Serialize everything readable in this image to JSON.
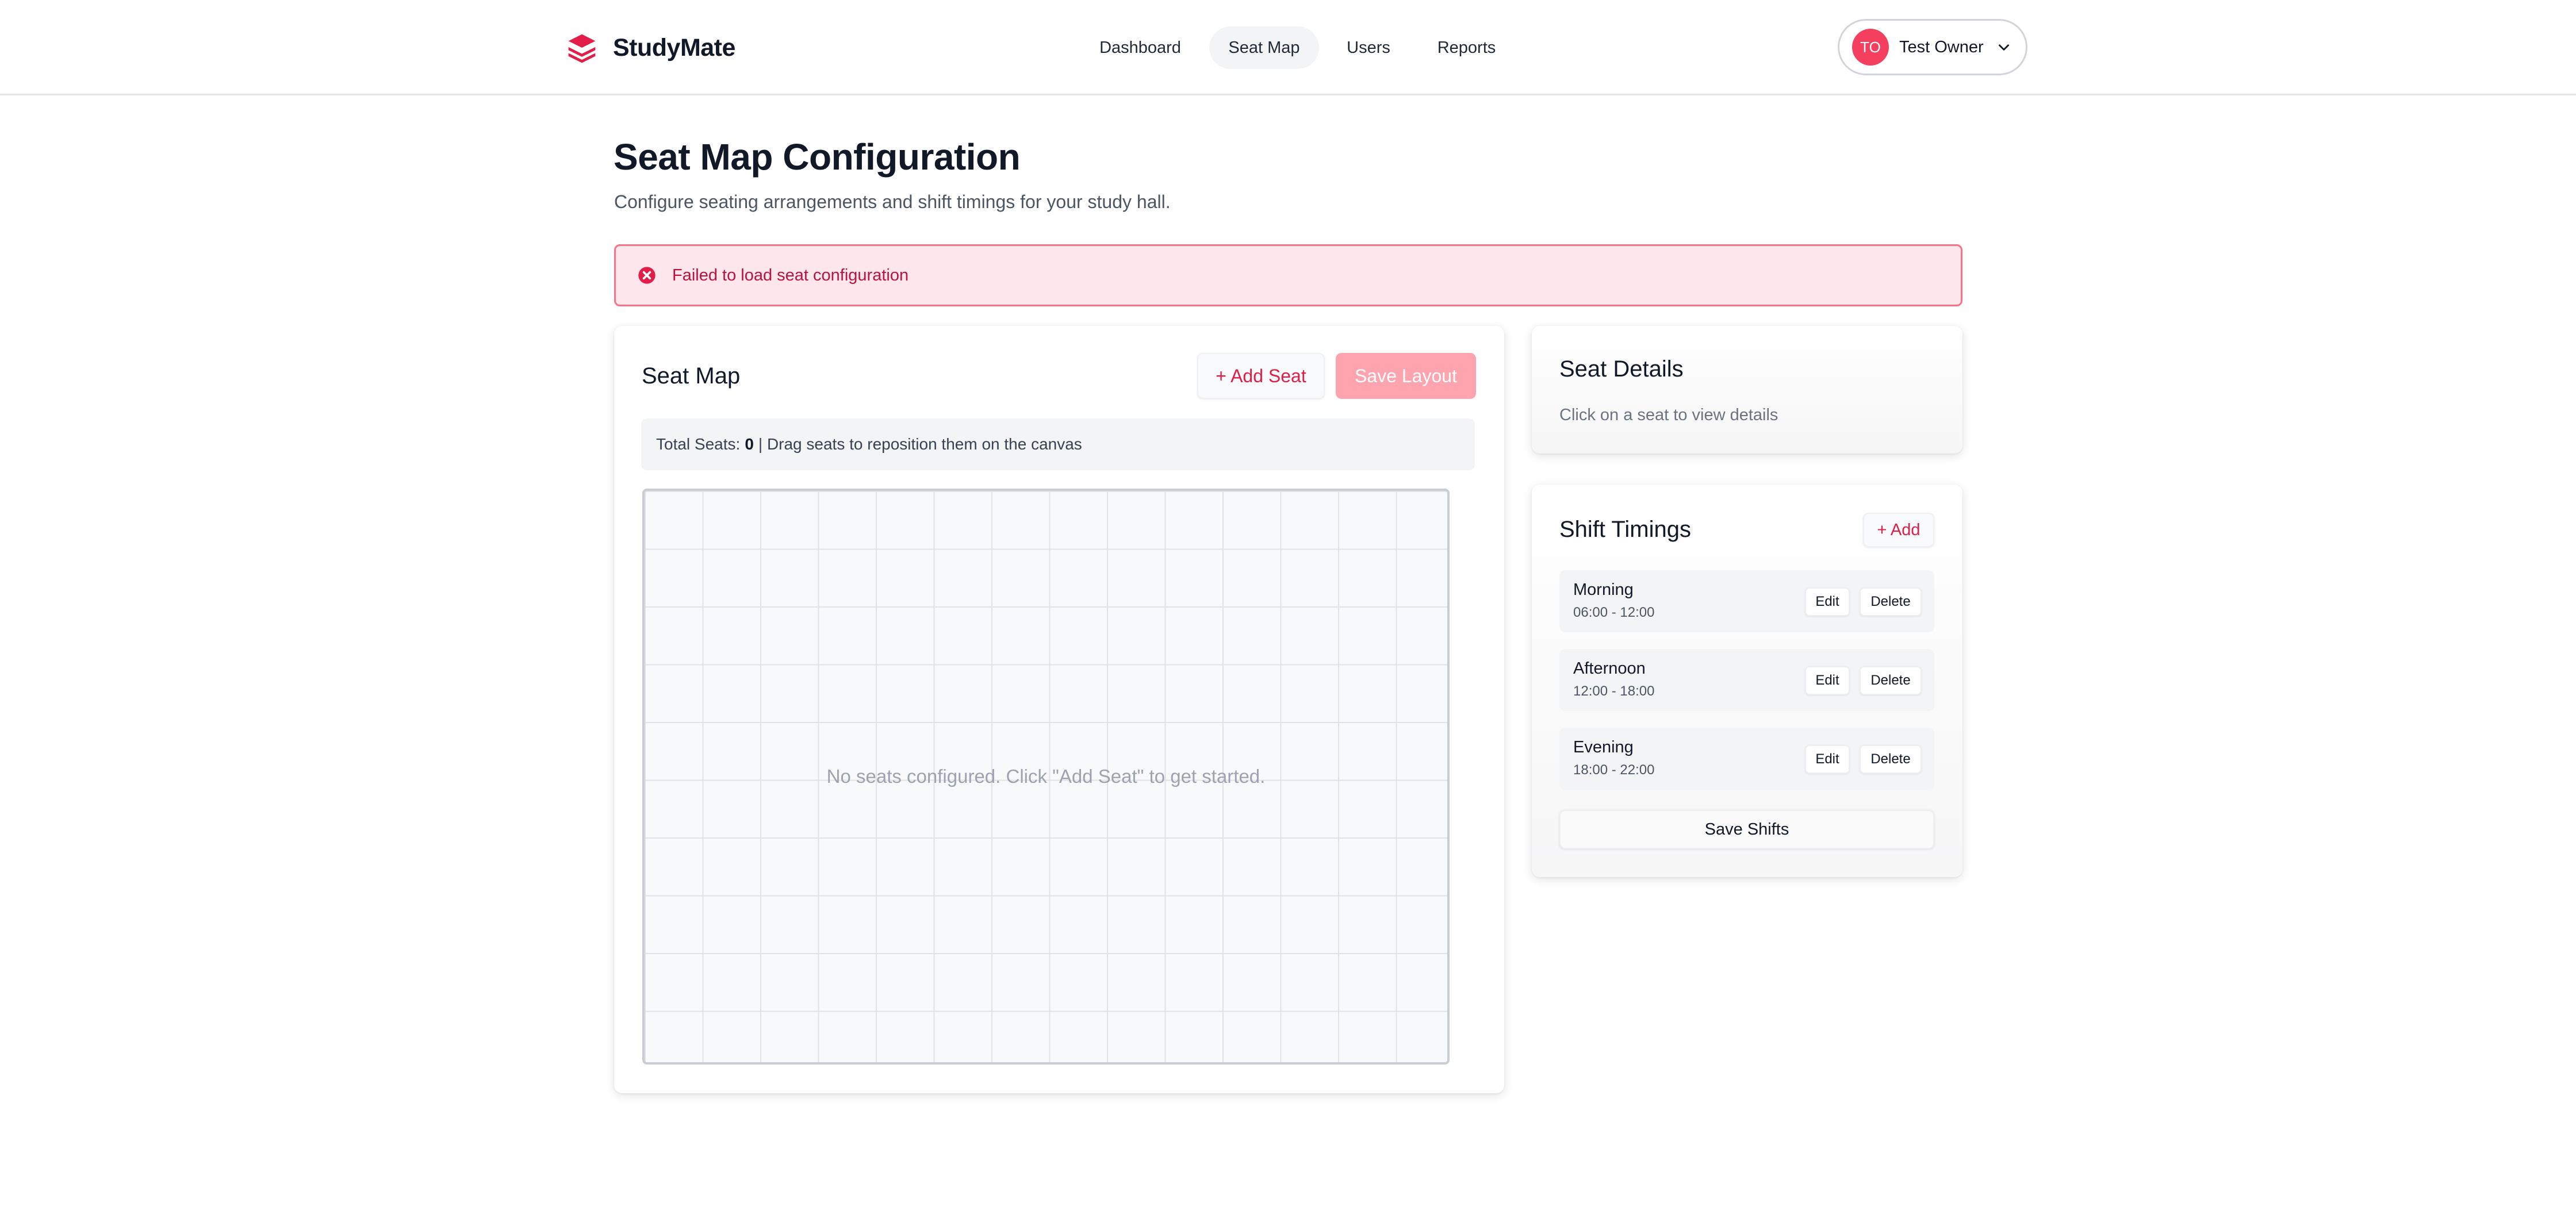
{
  "brand": {
    "name": "StudyMate",
    "icon": "layers-icon",
    "color": "#e11d48"
  },
  "nav": {
    "items": [
      {
        "label": "Dashboard",
        "active": false
      },
      {
        "label": "Seat Map",
        "active": true
      },
      {
        "label": "Users",
        "active": false
      },
      {
        "label": "Reports",
        "active": false
      }
    ]
  },
  "user": {
    "initials": "TO",
    "name": "Test Owner",
    "icon": "chevron-down-icon"
  },
  "header": {
    "title": "Seat Map Configuration",
    "subtitle": "Configure seating arrangements and shift timings for your study hall."
  },
  "alert": {
    "icon": "error-circle-icon",
    "message": "Failed to load seat configuration"
  },
  "seat_map": {
    "title": "Seat Map",
    "add_label": "+ Add Seat",
    "save_label": "Save Layout",
    "total_label": "Total Seats:",
    "total_value": "0",
    "hint": "| Drag seats to reposition them on the canvas",
    "empty_text": "No seats configured. Click \"Add Seat\" to get started."
  },
  "seat_details": {
    "title": "Seat Details",
    "placeholder": "Click on a seat to view details"
  },
  "shifts": {
    "title": "Shift Timings",
    "add_label": "+ Add",
    "items": [
      {
        "name": "Morning",
        "time": "06:00 - 12:00",
        "edit": "Edit",
        "delete": "Delete"
      },
      {
        "name": "Afternoon",
        "time": "12:00 - 18:00",
        "edit": "Edit",
        "delete": "Delete"
      },
      {
        "name": "Evening",
        "time": "18:00 - 22:00",
        "edit": "Edit",
        "delete": "Delete"
      }
    ],
    "save_label": "Save Shifts"
  },
  "colors": {
    "accent": "#e11d48",
    "accent_light": "#fda4af",
    "alert_bg": "#fde7ec",
    "alert_border": "#fb7185"
  }
}
